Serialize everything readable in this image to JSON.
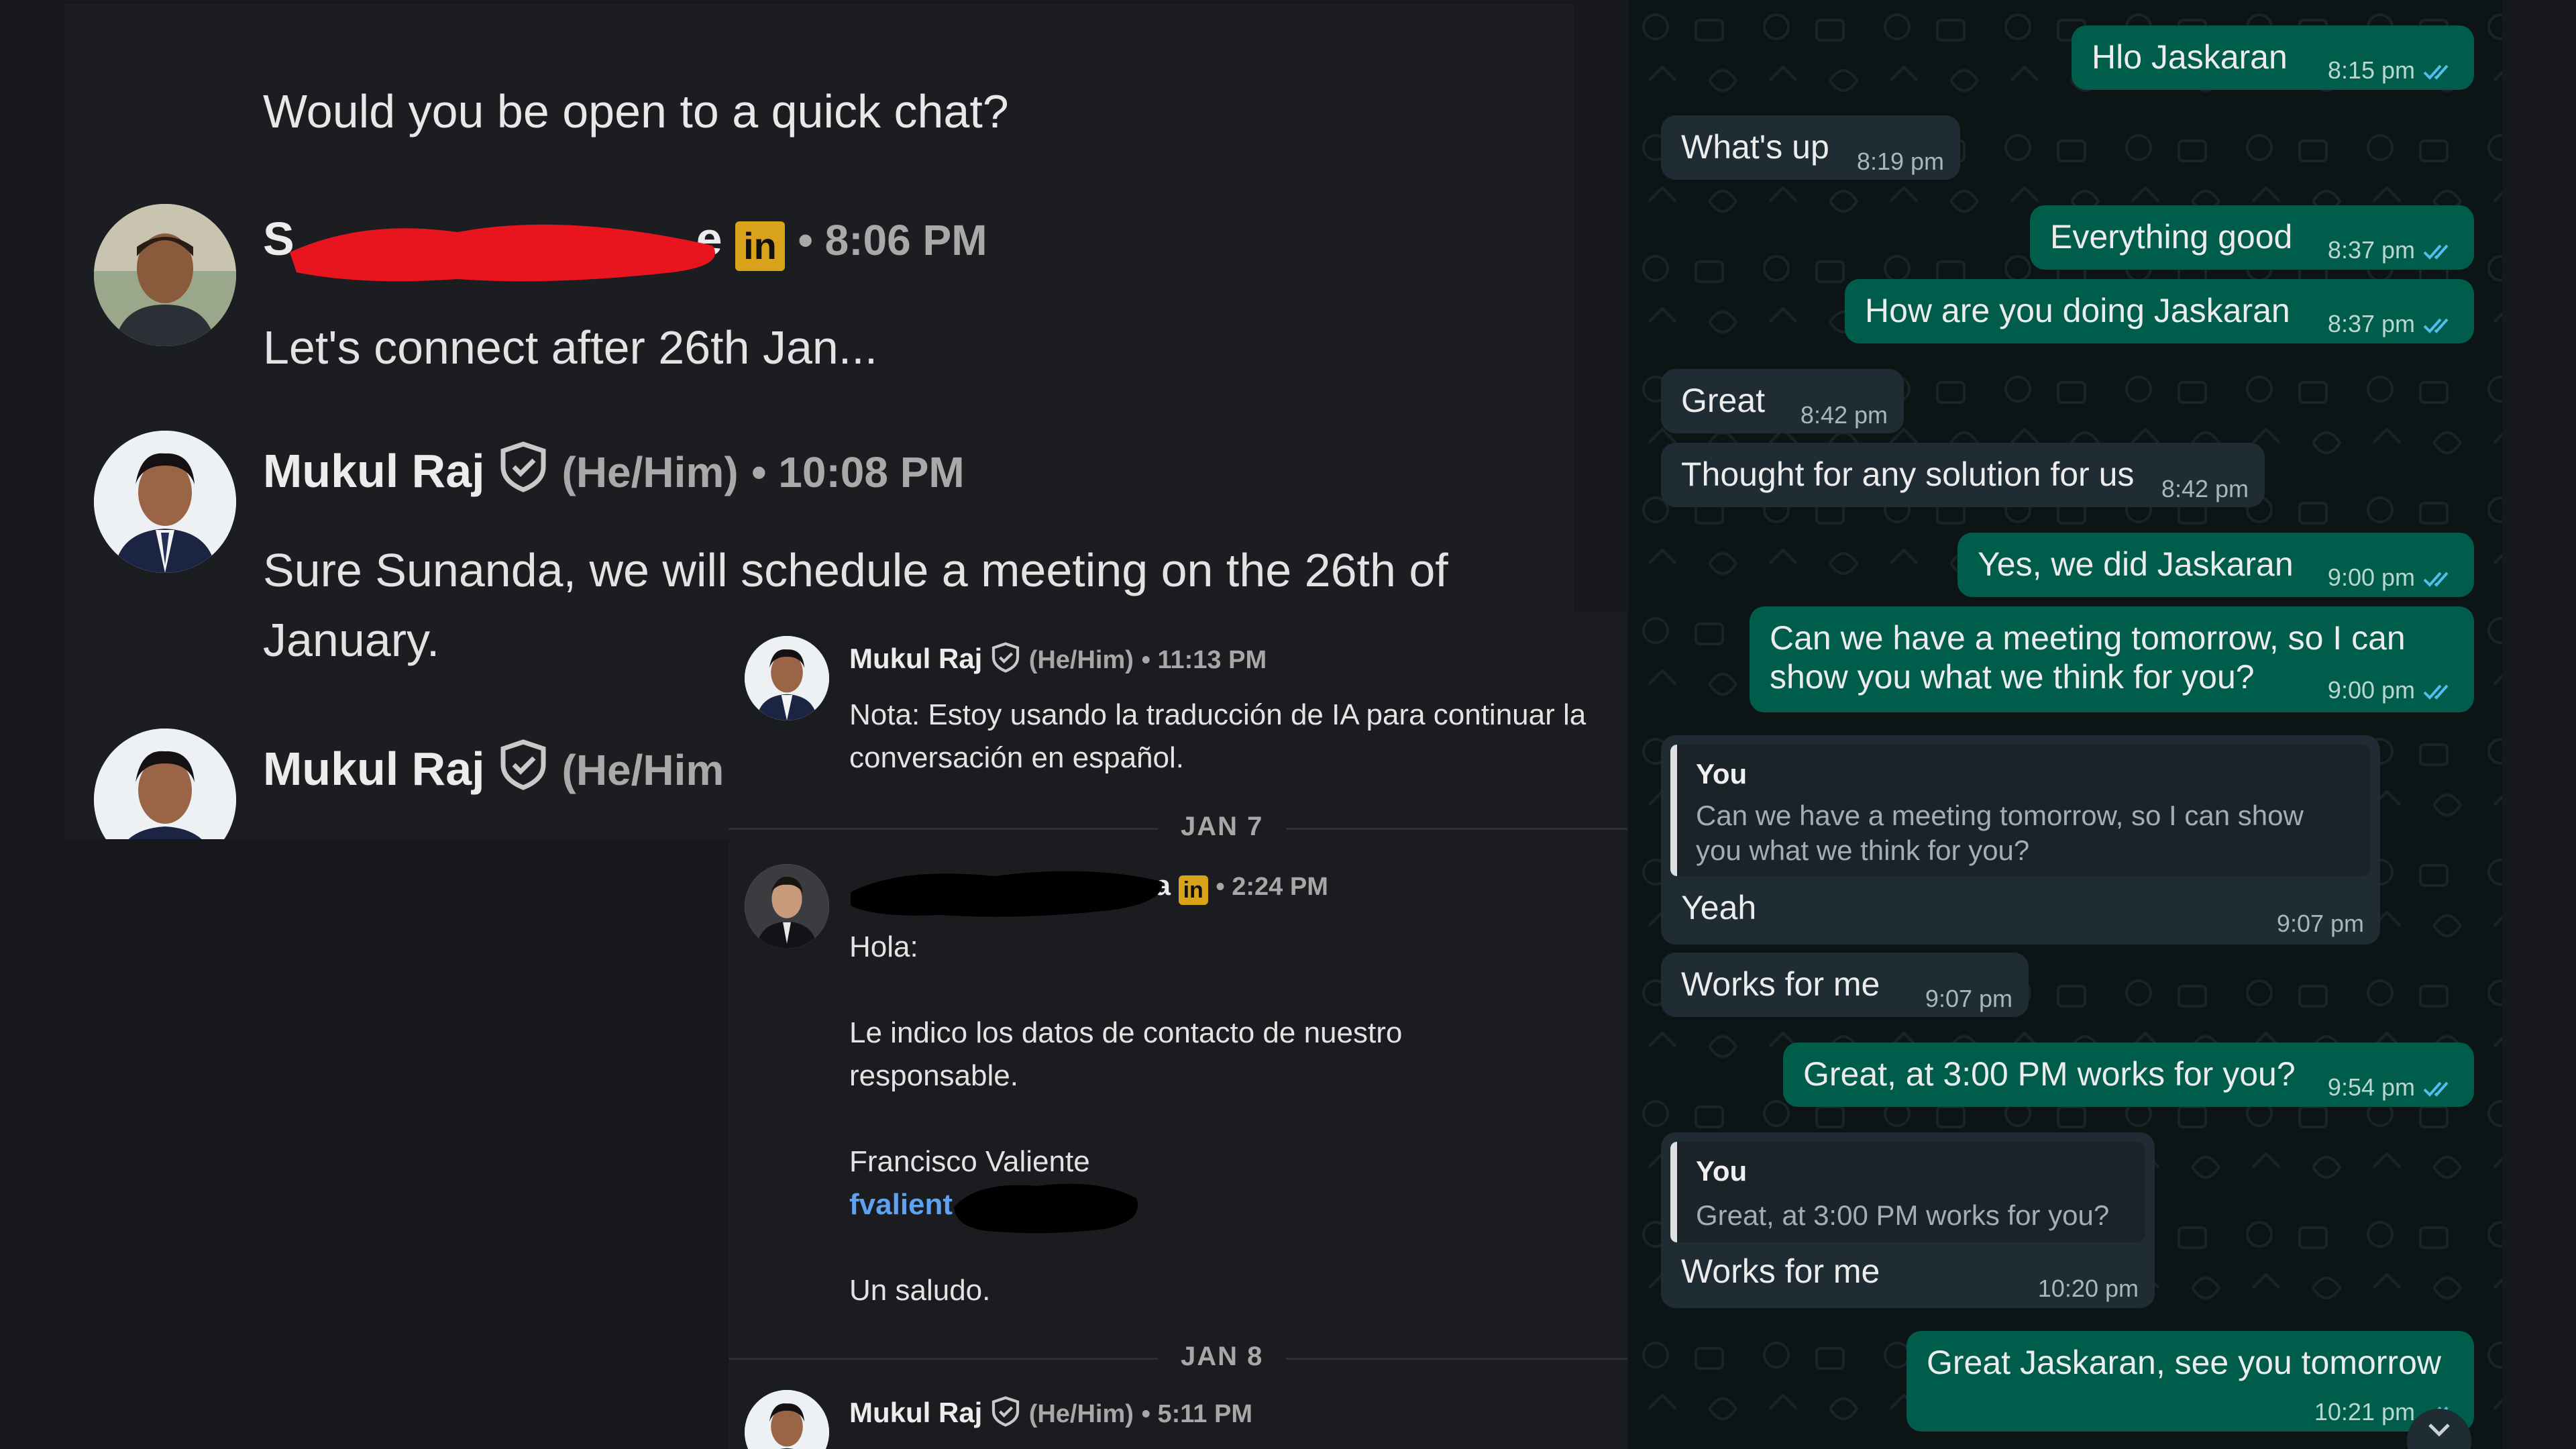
{
  "linkedin_thread_1": {
    "question_text": "Would you open to a quick chat?",
    "question_full": "Would you be open to a quick chat?",
    "msg1": {
      "sender_initial": "S",
      "sender_suffix": "e",
      "badge": "in",
      "time": "• 8:06 PM",
      "text": "Let's connect after 26th Jan..."
    },
    "msg2": {
      "sender": "Mukul Raj",
      "pronouns": "(He/Him)",
      "time": "• 10:08 PM",
      "text": "Sure Sunanda, we will schedule a meeting on the 26th of January."
    },
    "msg3": {
      "sender": "Mukul Raj",
      "pronouns": "(He/Him"
    }
  },
  "linkedin_thread_2": {
    "msg1": {
      "sender": "Mukul Raj",
      "pronouns": "(He/Him)",
      "time": "• 11:13 PM",
      "text": "Nota: Estoy usando la traducción de IA para continuar la conversación en español."
    },
    "date1": "JAN 7",
    "msg2": {
      "sender_suffix": "a",
      "badge": "in",
      "time": "• 2:24 PM",
      "greeting": "Hola:",
      "line": "Le indico los datos de contacto de nuestro responsable.",
      "contact_name": "Francisco Valiente",
      "contact_link": "fvalient",
      "closing": "Un saludo."
    },
    "date2": "JAN 8",
    "msg3": {
      "sender": "Mukul Raj",
      "pronouns": "(He/Him)",
      "time": "• 5:11 PM"
    }
  },
  "whatsapp": {
    "messages": [
      {
        "dir": "out",
        "text": "Hlo Jaskaran",
        "time": "8:15 pm"
      },
      {
        "dir": "in",
        "text": "What's up",
        "time": "8:19 pm"
      },
      {
        "dir": "out",
        "text": "Everything good",
        "time": "8:37 pm"
      },
      {
        "dir": "out",
        "text": "How are you doing Jaskaran",
        "time": "8:37 pm"
      },
      {
        "dir": "in",
        "text": "Great",
        "time": "8:42 pm"
      },
      {
        "dir": "in",
        "text": "Thought for any solution for us",
        "time": "8:42 pm"
      },
      {
        "dir": "out",
        "text": "Yes, we did Jaskaran",
        "time": "9:00 pm"
      },
      {
        "dir": "out",
        "text_line1": "Can we have a meeting tomorrow, so I can",
        "text_line2": "show you what we think for you?",
        "time": "9:00 pm"
      },
      {
        "dir": "in",
        "quote_author": "You",
        "quote_line1": "Can we have a meeting tomorrow, so I can show",
        "quote_line2": "you what we think for you?",
        "text": "Yeah",
        "time": "9:07 pm"
      },
      {
        "dir": "in",
        "text": "Works for me",
        "time": "9:07 pm"
      },
      {
        "dir": "out",
        "text": "Great, at 3:00 PM works for you?",
        "time": "9:54 pm"
      },
      {
        "dir": "in",
        "quote_author": "You",
        "quote_line1": "Great, at 3:00 PM works for you?",
        "text": "Works for me",
        "time": "10:20 pm"
      },
      {
        "dir": "out",
        "text": "Great Jaskaran, see you tomorrow",
        "time": "10:21 pm"
      }
    ]
  },
  "colors": {
    "linkedin_bg": "#1c1d20",
    "whatsapp_bg": "#0d1416",
    "whatsapp_out_bubble": "#005c4b",
    "whatsapp_in_bubble": "#202c33",
    "read_tick_blue": "#53bdeb",
    "link_blue": "#5da3f2",
    "linkedin_badge": "#d9a21b",
    "redaction_red": "#e8141e",
    "redaction_black": "#000000"
  },
  "icons": [
    "verified-shield-icon",
    "linkedin-premium-badge-icon",
    "read-ticks-icon",
    "scroll-down-chevron-icon"
  ]
}
